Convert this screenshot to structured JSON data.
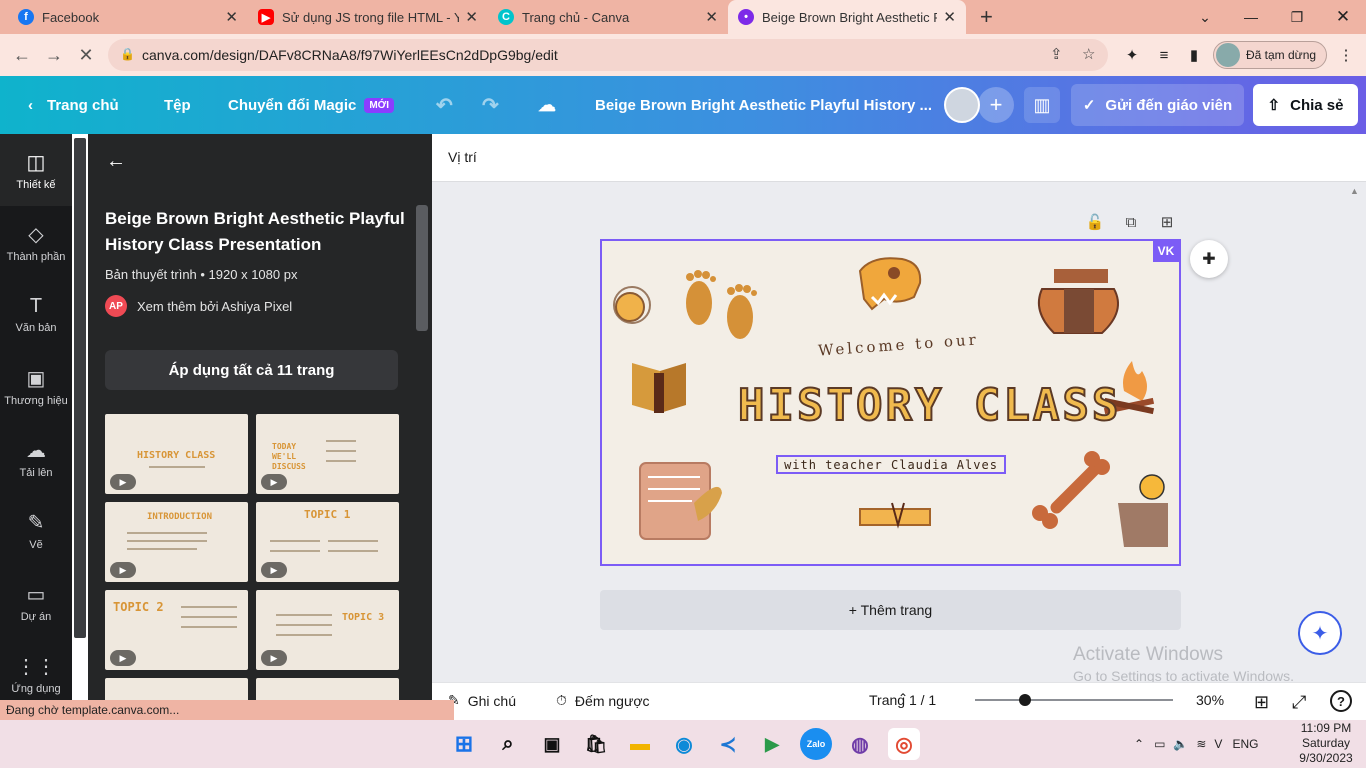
{
  "browser": {
    "tabs": [
      {
        "title": "Facebook",
        "icon": "facebook-icon",
        "color": "#1877f2"
      },
      {
        "title": "Sử dụng JS trong file HTML - You",
        "icon": "youtube-icon",
        "color": "#ff0000"
      },
      {
        "title": "Trang chủ - Canva",
        "icon": "canva-icon",
        "color": "#00c4cc"
      },
      {
        "title": "Beige Brown Bright Aesthetic Pla",
        "icon": "canva-design-icon",
        "color": "#7d2ae8"
      }
    ],
    "new_tab": "+",
    "url": "canva.com/design/DAFv8CRNaA8/f97WiYerlEEsCn2dDpG9bg/edit",
    "profile_label": "Đã tạm dừng"
  },
  "topbar": {
    "home": "Trang chủ",
    "file": "Tệp",
    "magic": "Chuyển đổi Magic",
    "magic_badge": "MỚI",
    "design_title": "Beige Brown Bright Aesthetic Playful History ...",
    "send_teacher": "Gửi đến giáo viên",
    "share": "Chia sẻ"
  },
  "rail": [
    {
      "label": "Thiết kế",
      "icon": "design-icon"
    },
    {
      "label": "Thành phần",
      "icon": "elements-icon"
    },
    {
      "label": "Văn bản",
      "icon": "text-icon"
    },
    {
      "label": "Thương hiệu",
      "icon": "brand-icon"
    },
    {
      "label": "Tải lên",
      "icon": "upload-icon"
    },
    {
      "label": "Vẽ",
      "icon": "draw-icon"
    },
    {
      "label": "Dự án",
      "icon": "projects-icon"
    },
    {
      "label": "Ứng dụng",
      "icon": "apps-icon"
    }
  ],
  "panel": {
    "title": "Beige Brown Bright Aesthetic Playful History Class Presentation",
    "meta": "Bản thuyết trình • 1920 x 1080 px",
    "author_initials": "AP",
    "author": "Xem thêm bởi Ashiya Pixel",
    "apply_all": "Áp dụng tất cả 11 trang",
    "thumbnails": [
      {
        "title": "HISTORY CLASS"
      },
      {
        "title": "TODAY WE'LL DISCUSS"
      },
      {
        "title": "INTRODUCTION"
      },
      {
        "title": "TOPIC 1"
      },
      {
        "title": "TOPIC 2"
      },
      {
        "title": "TOPIC 3"
      }
    ]
  },
  "canvas": {
    "position_label": "Vị trí",
    "collaborator_badge": "VK",
    "slide_welcome": "Welcome to our",
    "slide_title": "HISTORY CLASS",
    "slide_teacher": "with teacher Claudia Alves",
    "add_page": "+ Thêm trang"
  },
  "watermark": {
    "line1": "Activate Windows",
    "line2": "Go to Settings to activate Windows."
  },
  "footer": {
    "notes": "Ghi chú",
    "timer": "Đếm ngược",
    "page_indicator": "Trang 1 / 1",
    "zoom": "30%",
    "zoom_fraction": 0.25
  },
  "status": "Đang chờ template.canva.com...",
  "taskbar": {
    "language": "ENG",
    "time": "11:09 PM",
    "day": "Saturday",
    "date": "9/30/2023"
  }
}
